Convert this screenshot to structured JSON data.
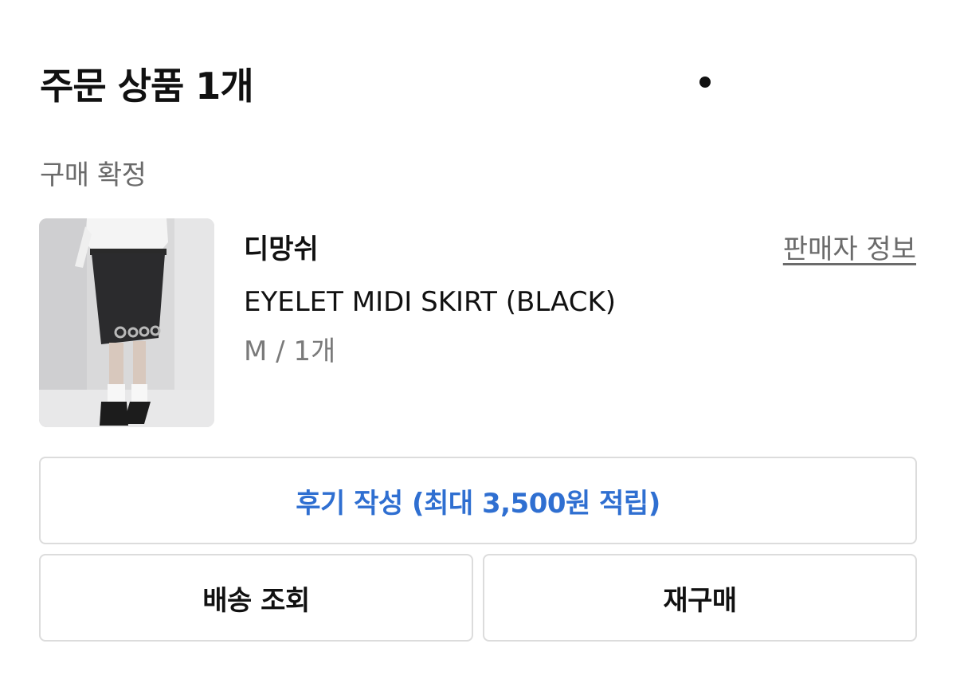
{
  "header": {
    "title": "주문 상품 1개"
  },
  "order": {
    "status": "구매 확정",
    "brand": "디망쉬",
    "seller_link": "판매자 정보",
    "product_name": "EYELET MIDI SKIRT (BLACK)",
    "option": "M / 1개"
  },
  "actions": {
    "review_label": "후기 작성 (최대 3,500원 적립)",
    "track_label": "배송 조회",
    "rebuy_label": "재구매"
  },
  "colors": {
    "accent": "#2f6fd1",
    "text_primary": "#111111",
    "text_secondary": "#6b6b6b",
    "border": "#dcdcdc"
  }
}
